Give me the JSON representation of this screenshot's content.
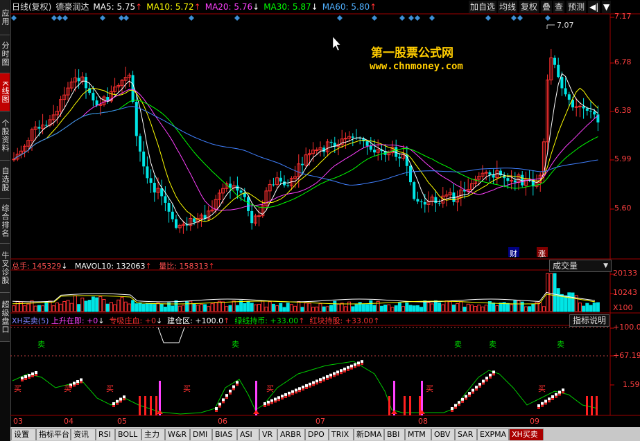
{
  "sidebar": {
    "tabs": [
      {
        "label": "应用"
      },
      {
        "label": "分时图"
      },
      {
        "label": "K线图"
      },
      {
        "label": "个股资料"
      },
      {
        "label": "自选股"
      },
      {
        "label": "综合排名"
      },
      {
        "label": "牛叉诊股"
      },
      {
        "label": "超级盘口"
      }
    ]
  },
  "header": {
    "period": "日线(复权)",
    "stock": "德豪润达",
    "ma5": "MA5: 5.75",
    "ma10": "MA10: 5.72",
    "ma20": "MA20: 5.76",
    "ma30": "MA30: 5.87",
    "ma60": "MA60: 5.80",
    "up": "↑",
    "down": "↓",
    "buttons": [
      "加自选",
      "均线",
      "复权",
      "叠",
      "查",
      "预测"
    ],
    "collapse": "◀|",
    "menu": "▼"
  },
  "price_axis": [
    "7.17",
    "6.78",
    "6.38",
    "5.99",
    "5.60"
  ],
  "annotations": {
    "high": "7.07",
    "cai": "财",
    "zhang": "涨"
  },
  "watermark": {
    "title": "第一股票公式网",
    "url": "www.chnmoney.com"
  },
  "volume": {
    "total": "总手: 145329",
    "mavol": "MAVOL10: 132063",
    "ratio": "量比: 158313",
    "dropdown": "成交量",
    "axis": [
      "20133",
      "10243",
      "X100"
    ]
  },
  "indicator": {
    "name": "XH买卖(5)",
    "rise": "上升在即: +0",
    "absorb": "专吸庄血: +0",
    "build": "建仓区: +100.0",
    "green": "绿线持币: +33.00",
    "red": "红块持股: +33.00",
    "explain": "指标说明",
    "axis": [
      "+100.0",
      "+67.19",
      "1.59"
    ],
    "sell": "卖",
    "buy": "买"
  },
  "months": [
    "03",
    "04",
    "05",
    "06",
    "07",
    "08",
    "09"
  ],
  "bottom_tabs": [
    "设置",
    "指标平台",
    "资讯",
    "RSI",
    "BOLL",
    "主力",
    "W&R",
    "DMI",
    "BIAS",
    "ASI",
    "VR",
    "ARBR",
    "DPO",
    "TRIX",
    "新DMA",
    "BBI",
    "MTM",
    "OBV",
    "SAR",
    "EXPMA",
    "XH买卖"
  ],
  "colors": {
    "up": "#ff3030",
    "down": "#00e5e5",
    "ma5": "#ffffff",
    "ma10": "#ffff00",
    "ma20": "#ff40ff",
    "ma30": "#00ff00",
    "ma60": "#4080ff"
  }
}
